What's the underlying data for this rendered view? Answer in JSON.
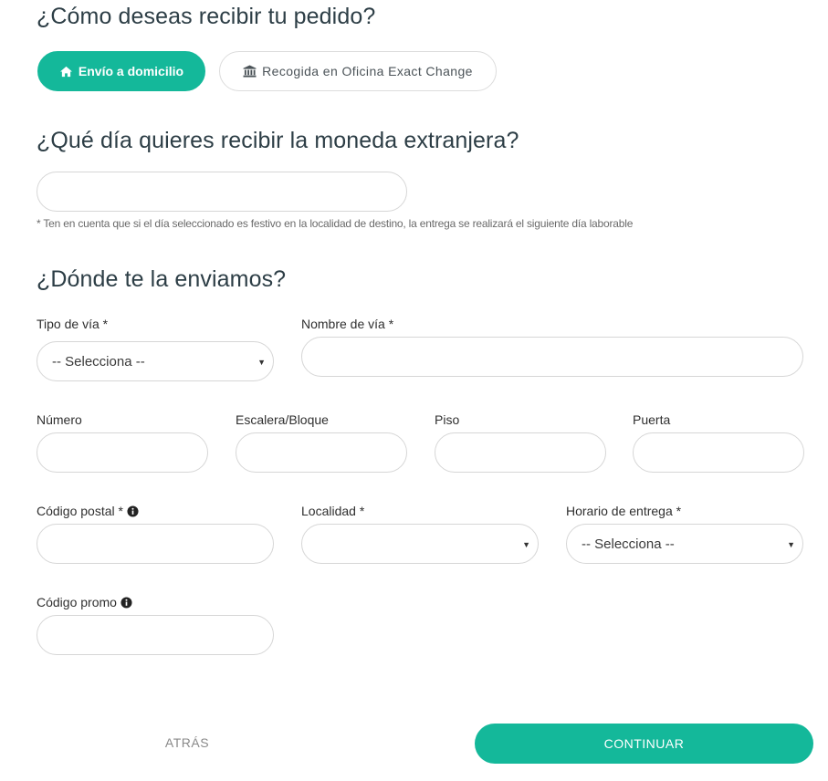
{
  "delivery": {
    "heading": "¿Cómo deseas recibir tu pedido?",
    "options": [
      {
        "label": "Envío a domicilio",
        "icon": "home-icon",
        "selected": true
      },
      {
        "label": "Recogida en Oficina Exact Change",
        "icon": "bank-icon",
        "selected": false
      }
    ]
  },
  "date": {
    "heading": "¿Qué día quieres recibir la moneda extranjera?",
    "value": "",
    "note": "* Ten en cuenta que si el día seleccionado es festivo en la localidad de destino, la entrega se realizará el siguiente día laborable"
  },
  "address": {
    "heading": "¿Dónde te la enviamos?",
    "tipo_via": {
      "label": "Tipo de vía *",
      "value": "-- Selecciona --"
    },
    "nombre_via": {
      "label": "Nombre de vía *",
      "value": ""
    },
    "numero": {
      "label": "Número",
      "value": ""
    },
    "escalera": {
      "label": "Escalera/Bloque",
      "value": ""
    },
    "piso": {
      "label": "Piso",
      "value": ""
    },
    "puerta": {
      "label": "Puerta",
      "value": ""
    },
    "codigo_postal": {
      "label": "Código postal *",
      "value": ""
    },
    "localidad": {
      "label": "Localidad *",
      "value": ""
    },
    "horario": {
      "label": "Horario de entrega *",
      "value": "-- Selecciona --"
    },
    "codigo_promo": {
      "label": "Código promo",
      "value": ""
    }
  },
  "actions": {
    "back": "ATRÁS",
    "continue": "CONTINUAR"
  },
  "colors": {
    "accent": "#14b89a",
    "border": "#d6d6d6",
    "heading": "#2d3e46"
  }
}
